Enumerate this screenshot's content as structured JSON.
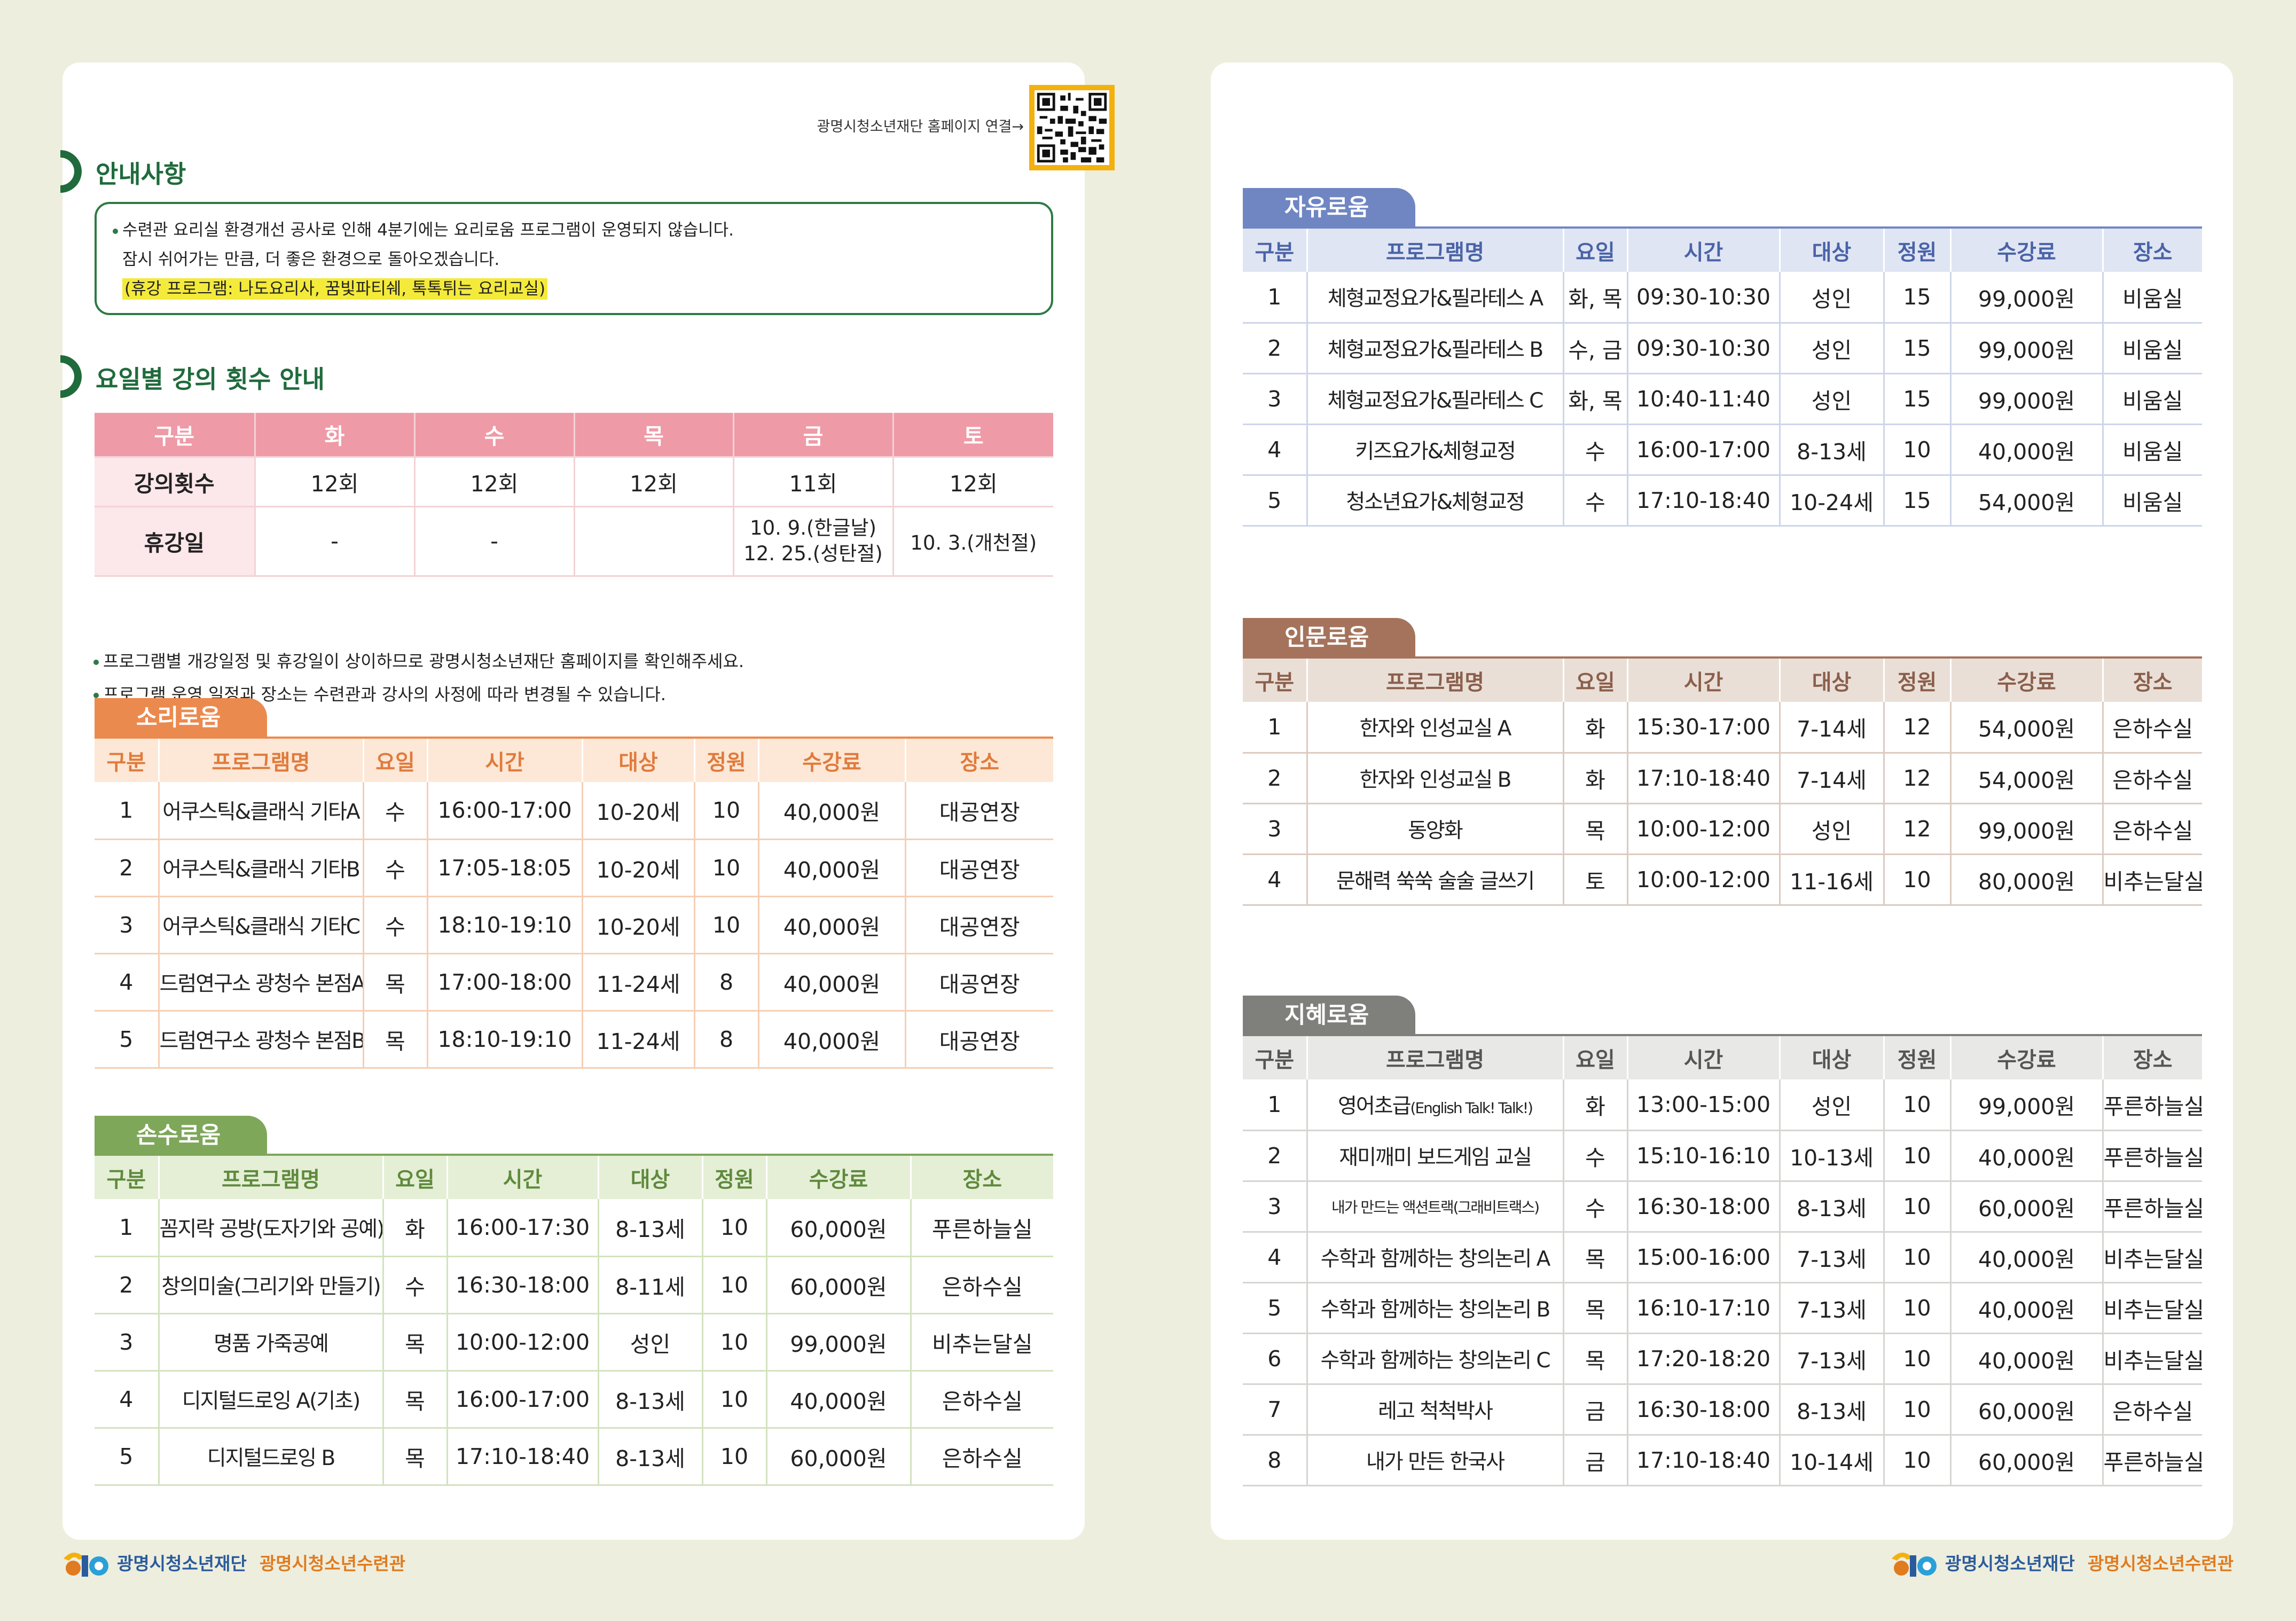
{
  "left": {
    "qr_label": "광명시청소년재단 홈페이지 연결→",
    "notice": {
      "title": "안내사항",
      "line1": "수련관 요리실 환경개선 공사로 인해 4분기에는 요리로움 프로그램이 운영되지 않습니다.",
      "line2": "잠시 쉬어가는 만큼, 더 좋은 환경으로 돌아오겠습니다.",
      "line3": "(휴강 프로그램: 나도요리사, 꿈빛파티쉐, 톡톡튀는 요리교실)"
    },
    "lectures": {
      "title": "요일별 강의 횟수 안내",
      "headers": [
        "구분",
        "화",
        "수",
        "목",
        "금",
        "토"
      ],
      "count_label": "강의횟수",
      "counts": [
        "12회",
        "12회",
        "12회",
        "11회",
        "12회"
      ],
      "holiday_label": "휴강일",
      "holidays": [
        "-",
        "-",
        "",
        "10. 9.(한글날)",
        "10. 3.(개천절)"
      ],
      "holiday_fri_2": "12. 25.(성탄절)"
    },
    "bullets": [
      "프로그램별 개강일정 및 휴강일이 상이하므로 광명시청소년재단 홈페이지를 확인해주세요.",
      "프로그램 운영 일정과 장소는 수련관과 강사의 사정에 따라 변경될 수 있습니다."
    ]
  },
  "columns": [
    "구분",
    "프로그램명",
    "요일",
    "시간",
    "대상",
    "정원",
    "수강료",
    "장소"
  ],
  "sori": {
    "tab": "소리로움",
    "rows": [
      [
        "1",
        "어쿠스틱&클래식 기타A",
        "수",
        "16:00-17:00",
        "10-20세",
        "10",
        "40,000원",
        "대공연장"
      ],
      [
        "2",
        "어쿠스틱&클래식 기타B",
        "수",
        "17:05-18:05",
        "10-20세",
        "10",
        "40,000원",
        "대공연장"
      ],
      [
        "3",
        "어쿠스틱&클래식 기타C",
        "수",
        "18:10-19:10",
        "10-20세",
        "10",
        "40,000원",
        "대공연장"
      ],
      [
        "4",
        "드럼연구소 광청수 본점A",
        "목",
        "17:00-18:00",
        "11-24세",
        "8",
        "40,000원",
        "대공연장"
      ],
      [
        "5",
        "드럼연구소 광청수 본점B",
        "목",
        "18:10-19:10",
        "11-24세",
        "8",
        "40,000원",
        "대공연장"
      ]
    ]
  },
  "sonsu": {
    "tab": "손수로움",
    "rows": [
      [
        "1",
        "꼼지락 공방(도자기와 공예)",
        "화",
        "16:00-17:30",
        "8-13세",
        "10",
        "60,000원",
        "푸른하늘실"
      ],
      [
        "2",
        "창의미술(그리기와 만들기)",
        "수",
        "16:30-18:00",
        "8-11세",
        "10",
        "60,000원",
        "은하수실"
      ],
      [
        "3",
        "명품 가죽공예",
        "목",
        "10:00-12:00",
        "성인",
        "10",
        "99,000원",
        "비추는달실"
      ],
      [
        "4",
        "디지털드로잉 A(기초)",
        "목",
        "16:00-17:00",
        "8-13세",
        "10",
        "40,000원",
        "은하수실"
      ],
      [
        "5",
        "디지털드로잉 B",
        "목",
        "17:10-18:40",
        "8-13세",
        "10",
        "60,000원",
        "은하수실"
      ]
    ]
  },
  "jayu": {
    "tab": "자유로움",
    "rows": [
      [
        "1",
        "체형교정요가&필라테스 A",
        "화, 목",
        "09:30-10:30",
        "성인",
        "15",
        "99,000원",
        "비움실"
      ],
      [
        "2",
        "체형교정요가&필라테스 B",
        "수, 금",
        "09:30-10:30",
        "성인",
        "15",
        "99,000원",
        "비움실"
      ],
      [
        "3",
        "체형교정요가&필라테스 C",
        "화, 목",
        "10:40-11:40",
        "성인",
        "15",
        "99,000원",
        "비움실"
      ],
      [
        "4",
        "키즈요가&체형교정",
        "수",
        "16:00-17:00",
        "8-13세",
        "10",
        "40,000원",
        "비움실"
      ],
      [
        "5",
        "청소년요가&체형교정",
        "수",
        "17:10-18:40",
        "10-24세",
        "15",
        "54,000원",
        "비움실"
      ]
    ]
  },
  "inmun": {
    "tab": "인문로움",
    "rows": [
      [
        "1",
        "한자와 인성교실 A",
        "화",
        "15:30-17:00",
        "7-14세",
        "12",
        "54,000원",
        "은하수실"
      ],
      [
        "2",
        "한자와 인성교실 B",
        "화",
        "17:10-18:40",
        "7-14세",
        "12",
        "54,000원",
        "은하수실"
      ],
      [
        "3",
        "동양화",
        "목",
        "10:00-12:00",
        "성인",
        "12",
        "99,000원",
        "은하수실"
      ],
      [
        "4",
        "문해력 쑥쑥 술술 글쓰기",
        "토",
        "10:00-12:00",
        "11-16세",
        "10",
        "80,000원",
        "비추는달실"
      ]
    ]
  },
  "jihye": {
    "tab": "지혜로움",
    "english_main": "영어초급",
    "english_sub": "(English Talk! Talk!)",
    "rows": [
      [
        "1",
        "",
        "화",
        "13:00-15:00",
        "성인",
        "10",
        "99,000원",
        "푸른하늘실"
      ],
      [
        "2",
        "재미깨미 보드게임 교실",
        "수",
        "15:10-16:10",
        "10-13세",
        "10",
        "40,000원",
        "푸른하늘실"
      ],
      [
        "3",
        "내가 만드는 액션트랙(그래비트랙스)",
        "수",
        "16:30-18:00",
        "8-13세",
        "10",
        "60,000원",
        "푸른하늘실"
      ],
      [
        "4",
        "수학과 함께하는 창의논리 A",
        "목",
        "15:00-16:00",
        "7-13세",
        "10",
        "40,000원",
        "비추는달실"
      ],
      [
        "5",
        "수학과 함께하는 창의논리 B",
        "목",
        "16:10-17:10",
        "7-13세",
        "10",
        "40,000원",
        "비추는달실"
      ],
      [
        "6",
        "수학과 함께하는 창의논리 C",
        "목",
        "17:20-18:20",
        "7-13세",
        "10",
        "40,000원",
        "비추는달실"
      ],
      [
        "7",
        "레고 척척박사",
        "금",
        "16:30-18:00",
        "8-13세",
        "10",
        "60,000원",
        "은하수실"
      ],
      [
        "8",
        "내가 만든 한국사",
        "금",
        "17:10-18:40",
        "10-14세",
        "10",
        "60,000원",
        "푸른하늘실"
      ]
    ]
  },
  "footer": {
    "org1": "광명시청소년재단",
    "org2": "광명시청소년수련관"
  },
  "colors": {
    "background": "#eeeede",
    "sori": "#eb8a4f",
    "sonsu": "#7ea75a",
    "jayu": "#6f86c3",
    "inmun": "#a5735c",
    "jihye": "#7f7f7b",
    "lecture_header": "#ef9aa7",
    "section_title": "#1f6b3c"
  },
  "icons": [
    "qr-code-icon",
    "foundation-logo-icon"
  ]
}
